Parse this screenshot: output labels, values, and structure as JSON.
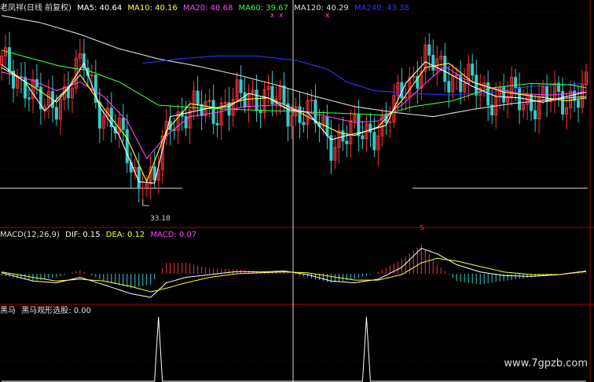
{
  "main_panel": {
    "title": "老凤祥(日线 前复权)",
    "ma_labels": [
      {
        "key": "ma5",
        "text": "MA5: 40.64",
        "color": "#ffffff"
      },
      {
        "key": "ma10",
        "text": "MA10: 40.16",
        "color": "#ffff33"
      },
      {
        "key": "ma20",
        "text": "MA20: 40.68",
        "color": "#ff44ff"
      },
      {
        "key": "ma60",
        "text": "MA60: 39.67",
        "color": "#33ff33"
      },
      {
        "key": "ma120",
        "text": "MA120: 40.29",
        "color": "#dddddd"
      },
      {
        "key": "ma240",
        "text": "MA240: 43.38",
        "color": "#3333ff"
      }
    ],
    "low_label": "33.18",
    "markers": [
      "x",
      "x",
      "x"
    ]
  },
  "macd_panel": {
    "title": "MACD(12,26,9)",
    "dif": "DIF: 0.15",
    "dea": "DEA: 0.12",
    "macd": "MACD: 0.07",
    "dif_color": "#ffffff",
    "dea_color": "#ffff33",
    "macd_color": "#ff44ff",
    "marker": "S"
  },
  "bottom_panel": {
    "title": "黑马",
    "indicator": "黑马观形选股: 0.00"
  },
  "watermark": "www.7gpzb.com",
  "colors": {
    "up": "#ff3333",
    "down": "#33cccc",
    "border": "#aa0000",
    "background": "#000000"
  },
  "chart_data": [
    {
      "type": "line",
      "title": "老凤祥(日线 前复权)",
      "x_count": 150,
      "ylim": [
        31.5,
        46
      ],
      "low_value": 33.18,
      "low_index": 36,
      "series": [
        {
          "name": "MA120",
          "color": "#dddddd",
          "points": [
            [
              0,
              45.9
            ],
            [
              10,
              45.4
            ],
            [
              20,
              44.6
            ],
            [
              30,
              43.6
            ],
            [
              40,
              42.9
            ],
            [
              50,
              42.4
            ],
            [
              60,
              41.8
            ],
            [
              70,
              41.1
            ],
            [
              80,
              40.3
            ],
            [
              90,
              39.6
            ],
            [
              100,
              39.2
            ],
            [
              110,
              38.9
            ],
            [
              120,
              39.4
            ],
            [
              130,
              39.8
            ],
            [
              140,
              40.1
            ],
            [
              149,
              40.3
            ]
          ]
        },
        {
          "name": "MA240",
          "color": "#3333ff",
          "points": [
            [
              36,
              42.6
            ],
            [
              45,
              42.9
            ],
            [
              55,
              43.1
            ],
            [
              65,
              43.1
            ],
            [
              75,
              42.8
            ],
            [
              83,
              42.2
            ],
            [
              88,
              41.3
            ],
            [
              95,
              40.7
            ],
            [
              105,
              40.5
            ],
            [
              115,
              40.4
            ],
            [
              125,
              40.6
            ],
            [
              135,
              41.0
            ],
            [
              149,
              41.2
            ]
          ]
        },
        {
          "name": "MA60",
          "color": "#33ff33",
          "points": [
            [
              0,
              43.5
            ],
            [
              8,
              42.9
            ],
            [
              15,
              42.4
            ],
            [
              22,
              42.1
            ],
            [
              30,
              41.3
            ],
            [
              40,
              39.7
            ],
            [
              50,
              39.5
            ],
            [
              60,
              39.4
            ],
            [
              70,
              39.3
            ],
            [
              80,
              39.2
            ],
            [
              90,
              39.1
            ],
            [
              97,
              39.0
            ],
            [
              105,
              39.6
            ],
            [
              115,
              40.0
            ],
            [
              125,
              40.9
            ],
            [
              135,
              41.2
            ],
            [
              145,
              41.1
            ],
            [
              149,
              40.9
            ]
          ]
        },
        {
          "name": "MA20",
          "color": "#ff44ff",
          "points": [
            [
              0,
              42.0
            ],
            [
              8,
              41.4
            ],
            [
              14,
              40.7
            ],
            [
              20,
              41.3
            ],
            [
              26,
              40.3
            ],
            [
              32,
              38.6
            ],
            [
              37,
              36.0
            ],
            [
              42,
              37.6
            ],
            [
              48,
              38.9
            ],
            [
              55,
              39.2
            ],
            [
              62,
              39.6
            ],
            [
              70,
              39.7
            ],
            [
              78,
              39.2
            ],
            [
              85,
              38.8
            ],
            [
              90,
              38.5
            ],
            [
              96,
              38.6
            ],
            [
              102,
              39.7
            ],
            [
              108,
              41.2
            ],
            [
              113,
              42.4
            ],
            [
              118,
              41.5
            ],
            [
              125,
              40.9
            ],
            [
              132,
              40.5
            ],
            [
              140,
              40.4
            ],
            [
              149,
              40.6
            ]
          ]
        },
        {
          "name": "MA10",
          "color": "#ffff33",
          "points": [
            [
              0,
              42.3
            ],
            [
              8,
              41.0
            ],
            [
              14,
              39.9
            ],
            [
              20,
              41.8
            ],
            [
              26,
              39.5
            ],
            [
              32,
              37.4
            ],
            [
              37,
              34.4
            ],
            [
              42,
              37.9
            ],
            [
              48,
              39.8
            ],
            [
              55,
              39.5
            ],
            [
              62,
              40.1
            ],
            [
              68,
              40.2
            ],
            [
              74,
              39.5
            ],
            [
              80,
              38.6
            ],
            [
              86,
              37.8
            ],
            [
              90,
              37.6
            ],
            [
              96,
              38.2
            ],
            [
              102,
              40.0
            ],
            [
              108,
              42.3
            ],
            [
              114,
              42.6
            ],
            [
              120,
              41.3
            ],
            [
              128,
              40.6
            ],
            [
              136,
              40.3
            ],
            [
              144,
              40.0
            ],
            [
              149,
              40.2
            ]
          ]
        },
        {
          "name": "MA5",
          "color": "#ffffff",
          "points": [
            [
              0,
              42.5
            ],
            [
              6,
              41.3
            ],
            [
              11,
              39.3
            ],
            [
              17,
              40.9
            ],
            [
              21,
              42.6
            ],
            [
              25,
              39.6
            ],
            [
              30,
              37.6
            ],
            [
              35,
              34.4
            ],
            [
              39,
              34.3
            ],
            [
              43,
              38.9
            ],
            [
              48,
              39.2
            ],
            [
              53,
              39.5
            ],
            [
              58,
              39.6
            ],
            [
              63,
              40.5
            ],
            [
              68,
              40.2
            ],
            [
              73,
              39.4
            ],
            [
              78,
              39.2
            ],
            [
              84,
              37.3
            ],
            [
              88,
              37.6
            ],
            [
              93,
              37.9
            ],
            [
              98,
              38.3
            ],
            [
              103,
              41.2
            ],
            [
              108,
              42.7
            ],
            [
              114,
              41.9
            ],
            [
              120,
              41.0
            ],
            [
              126,
              40.3
            ],
            [
              132,
              40.2
            ],
            [
              138,
              39.9
            ],
            [
              144,
              40.3
            ],
            [
              149,
              40.6
            ]
          ]
        }
      ]
    },
    {
      "type": "bar",
      "title": "MACD(12,26,9)",
      "x_count": 150,
      "ylim": [
        -1.6,
        1.9
      ],
      "series": [
        {
          "name": "DIF",
          "color": "#ffffff",
          "points": [
            [
              0,
              0.05
            ],
            [
              8,
              -0.4
            ],
            [
              14,
              -0.5
            ],
            [
              20,
              -0.2
            ],
            [
              26,
              -0.6
            ],
            [
              33,
              -1.1
            ],
            [
              38,
              -1.3
            ],
            [
              42,
              -0.5
            ],
            [
              47,
              -0.2
            ],
            [
              53,
              -0.05
            ],
            [
              60,
              0.12
            ],
            [
              66,
              0.1
            ],
            [
              72,
              0.15
            ],
            [
              78,
              -0.05
            ],
            [
              84,
              -0.4
            ],
            [
              90,
              -0.5
            ],
            [
              96,
              -0.3
            ],
            [
              102,
              0.35
            ],
            [
              107,
              1.4
            ],
            [
              111,
              1.1
            ],
            [
              116,
              0.5
            ],
            [
              122,
              0.1
            ],
            [
              128,
              -0.1
            ],
            [
              135,
              -0.15
            ],
            [
              142,
              -0.05
            ],
            [
              149,
              0.15
            ]
          ]
        },
        {
          "name": "DEA",
          "color": "#ffff33",
          "points": [
            [
              0,
              0.1
            ],
            [
              8,
              -0.2
            ],
            [
              14,
              -0.4
            ],
            [
              20,
              -0.3
            ],
            [
              26,
              -0.4
            ],
            [
              33,
              -0.7
            ],
            [
              38,
              -1.0
            ],
            [
              42,
              -0.8
            ],
            [
              47,
              -0.5
            ],
            [
              53,
              -0.2
            ],
            [
              60,
              0.0
            ],
            [
              66,
              0.05
            ],
            [
              72,
              0.1
            ],
            [
              78,
              0.05
            ],
            [
              84,
              -0.15
            ],
            [
              90,
              -0.35
            ],
            [
              96,
              -0.35
            ],
            [
              102,
              -0.05
            ],
            [
              107,
              0.6
            ],
            [
              111,
              0.85
            ],
            [
              116,
              0.7
            ],
            [
              122,
              0.4
            ],
            [
              128,
              0.1
            ],
            [
              135,
              -0.05
            ],
            [
              142,
              -0.05
            ],
            [
              149,
              0.12
            ]
          ]
        },
        {
          "name": "MACD",
          "color": "#ff44ff",
          "values_note": "histogram ~ 2*(DIF-DEA)"
        }
      ]
    },
    {
      "type": "line",
      "title": "黑马",
      "x_count": 150,
      "ylim": [
        0,
        1
      ],
      "series": [
        {
          "name": "黑马观形选股",
          "color": "#ffffff",
          "points": [
            [
              0,
              0
            ],
            [
              39,
              0
            ],
            [
              40,
              1
            ],
            [
              41,
              0
            ],
            [
              92,
              0
            ],
            [
              93,
              1
            ],
            [
              94,
              0
            ],
            [
              149,
              0
            ]
          ]
        }
      ]
    }
  ]
}
